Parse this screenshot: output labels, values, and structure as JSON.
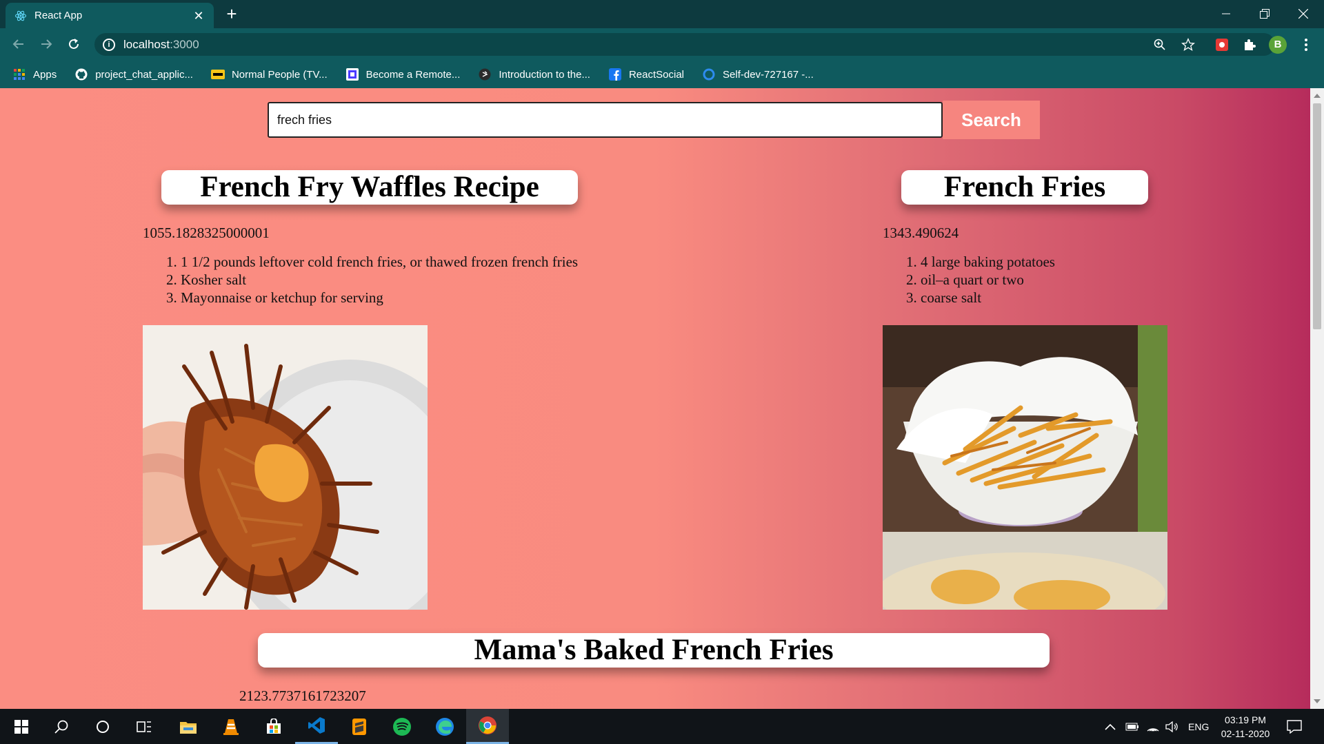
{
  "browser": {
    "tab_title": "React App",
    "url_host": "localhost",
    "url_port": ":3000",
    "bookmarks": [
      {
        "label": "Apps",
        "icon": "apps-grid-icon"
      },
      {
        "label": "project_chat_applic...",
        "icon": "github-icon"
      },
      {
        "label": "Normal People (TV...",
        "icon": "imdb-icon"
      },
      {
        "label": "Become a Remote...",
        "icon": "remote-icon"
      },
      {
        "label": "Introduction to the...",
        "icon": "course-icon"
      },
      {
        "label": "ReactSocial",
        "icon": "facebook-icon"
      },
      {
        "label": "Self-dev-727167 -...",
        "icon": "circle-icon"
      }
    ],
    "profile_initial": "B"
  },
  "search": {
    "value": "frech fries",
    "button_label": "Search"
  },
  "recipes": [
    {
      "title": "French Fry Waffles Recipe",
      "calories": "1055.1828325000001",
      "ingredients": [
        "1 1/2 pounds leftover cold french fries, or thawed frozen french fries",
        "Kosher salt",
        "Mayonnaise or ketchup for serving"
      ],
      "image": "waffle-fries-photo"
    },
    {
      "title": "French Fries",
      "calories": "1343.490624",
      "ingredients": [
        "4 large baking potatoes",
        "oil–a quart or two",
        "coarse salt"
      ],
      "image": "fries-bowl-photo"
    },
    {
      "title": "Mama's Baked French Fries",
      "calories": "2123.7737161723207"
    }
  ],
  "taskbar": {
    "language": "ENG",
    "time": "03:19 PM",
    "date": "02-11-2020"
  },
  "colors": {
    "page_gradient_start": "#fb8d82",
    "page_gradient_end": "#b62c5c",
    "chrome_frame": "#0d3a3f",
    "chrome_toolbar": "#0f5a5e",
    "search_button": "#f6857f"
  }
}
